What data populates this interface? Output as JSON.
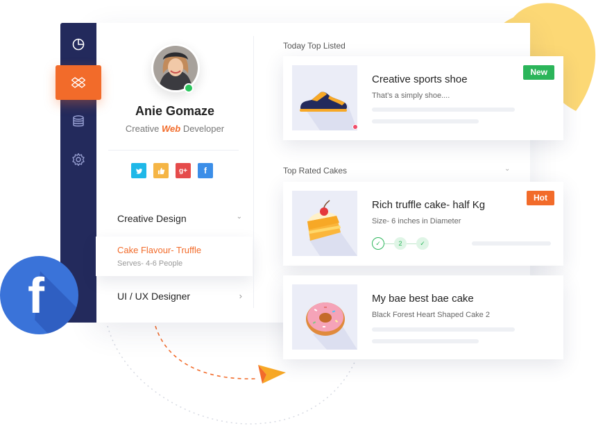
{
  "profile": {
    "name": "Anie Gomaze",
    "role_prefix": "Creative",
    "role_highlight": "Web",
    "role_suffix": "Developer"
  },
  "socials": [
    {
      "icon": "twitter-icon",
      "glyph": "t",
      "color": "#1fb8e8"
    },
    {
      "icon": "thumbs-up-icon",
      "glyph": "✌",
      "color": "#f5b545"
    },
    {
      "icon": "google-plus-icon",
      "glyph": "g+",
      "color": "#e54b4b"
    },
    {
      "icon": "facebook-icon",
      "glyph": "f",
      "color": "#3b8ee8"
    }
  ],
  "sidebar": {
    "items": [
      {
        "icon": "pie-chart-icon"
      },
      {
        "icon": "dropbox-icon",
        "active": true
      },
      {
        "icon": "database-icon"
      },
      {
        "icon": "gear-icon"
      }
    ]
  },
  "accordion": {
    "creative_design": "Creative Design",
    "open_item_title": "Cake Flavour- Truffle",
    "open_item_sub": "Serves- 4-6 People",
    "ux_designer": "UI / UX Designer"
  },
  "sections": {
    "today": "Today Top Listed",
    "top_rated": "Top Rated Cakes"
  },
  "products": [
    {
      "title": "Creative sports shoe",
      "subtitle": "That’s a simply shoe....",
      "badge": "New",
      "badge_color": "#2bb55a",
      "icon": "shoe-icon"
    },
    {
      "title": "Rich truffle cake- half Kg",
      "subtitle": "Size- 6 inches in Diameter",
      "badge": "Hot",
      "badge_color": "#f26b2a",
      "icon": "cake-slice-icon",
      "step": "2"
    },
    {
      "title": "My bae best bae cake",
      "subtitle": "Black Forest Heart Shaped Cake 2",
      "icon": "donut-icon"
    }
  ],
  "colors": {
    "accent": "#f26b2a",
    "sidebar": "#232a5c",
    "online": "#2bc55d",
    "facebook": "#3a73d9",
    "blob": "#fcd875"
  }
}
